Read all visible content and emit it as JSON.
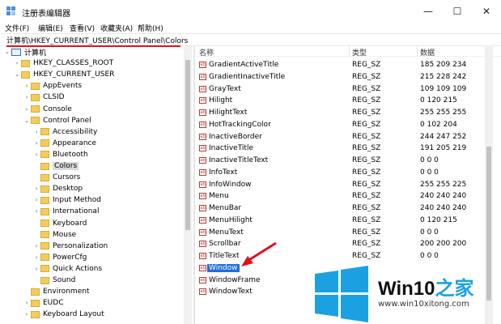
{
  "window": {
    "title": "注册表编辑器",
    "minimize": "—",
    "maximize": "☐",
    "close": "✕"
  },
  "menu": [
    "文件(F)",
    "编辑(E)",
    "查看(V)",
    "收藏夹(A)",
    "帮助(H)"
  ],
  "address": "计算机\\HKEY_CURRENT_USER\\Control Panel\\Colors",
  "tree": [
    {
      "label": "计算机",
      "exp": "⌄",
      "type": "computer",
      "depth": 0
    },
    {
      "label": "HKEY_CLASSES_ROOT",
      "exp": "›",
      "depth": 1
    },
    {
      "label": "HKEY_CURRENT_USER",
      "exp": "⌄",
      "depth": 1
    },
    {
      "label": "AppEvents",
      "exp": "›",
      "depth": 2
    },
    {
      "label": "CLSID",
      "exp": "›",
      "depth": 2
    },
    {
      "label": "Console",
      "exp": "›",
      "depth": 2
    },
    {
      "label": "Control Panel",
      "exp": "⌄",
      "depth": 2
    },
    {
      "label": "Accessibility",
      "exp": "›",
      "depth": 3
    },
    {
      "label": "Appearance",
      "exp": "›",
      "depth": 3
    },
    {
      "label": "Bluetooth",
      "exp": "›",
      "depth": 3
    },
    {
      "label": "Colors",
      "exp": "",
      "depth": 3,
      "selected": true
    },
    {
      "label": "Cursors",
      "exp": "",
      "depth": 3
    },
    {
      "label": "Desktop",
      "exp": "›",
      "depth": 3
    },
    {
      "label": "Input Method",
      "exp": "›",
      "depth": 3
    },
    {
      "label": "International",
      "exp": "›",
      "depth": 3
    },
    {
      "label": "Keyboard",
      "exp": "",
      "depth": 3
    },
    {
      "label": "Mouse",
      "exp": "",
      "depth": 3
    },
    {
      "label": "Personalization",
      "exp": "›",
      "depth": 3
    },
    {
      "label": "PowerCfg",
      "exp": "›",
      "depth": 3
    },
    {
      "label": "Quick Actions",
      "exp": "›",
      "depth": 3
    },
    {
      "label": "Sound",
      "exp": "",
      "depth": 3
    },
    {
      "label": "Environment",
      "exp": "",
      "depth": 2
    },
    {
      "label": "EUDC",
      "exp": "›",
      "depth": 2
    },
    {
      "label": "Keyboard Layout",
      "exp": "›",
      "depth": 2
    }
  ],
  "columns": {
    "name": "名称",
    "type": "类型",
    "data": "数据"
  },
  "values": [
    {
      "name": "GradientActiveTitle",
      "type": "REG_SZ",
      "data": "185 209 234"
    },
    {
      "name": "GradientInactiveTitle",
      "type": "REG_SZ",
      "data": "215 228 242"
    },
    {
      "name": "GrayText",
      "type": "REG_SZ",
      "data": "109 109 109"
    },
    {
      "name": "Hilight",
      "type": "REG_SZ",
      "data": "0 120 215"
    },
    {
      "name": "HilightText",
      "type": "REG_SZ",
      "data": "255 255 255"
    },
    {
      "name": "HotTrackingColor",
      "type": "REG_SZ",
      "data": "0 102 204"
    },
    {
      "name": "InactiveBorder",
      "type": "REG_SZ",
      "data": "244 247 252"
    },
    {
      "name": "InactiveTitle",
      "type": "REG_SZ",
      "data": "191 205 219"
    },
    {
      "name": "InactiveTitleText",
      "type": "REG_SZ",
      "data": "0 0 0"
    },
    {
      "name": "InfoText",
      "type": "REG_SZ",
      "data": "0 0 0"
    },
    {
      "name": "InfoWindow",
      "type": "REG_SZ",
      "data": "255 255 225"
    },
    {
      "name": "Menu",
      "type": "REG_SZ",
      "data": "240 240 240"
    },
    {
      "name": "MenuBar",
      "type": "REG_SZ",
      "data": "240 240 240"
    },
    {
      "name": "MenuHilight",
      "type": "REG_SZ",
      "data": "0 120 215"
    },
    {
      "name": "MenuText",
      "type": "REG_SZ",
      "data": "0 0 0"
    },
    {
      "name": "Scrollbar",
      "type": "REG_SZ",
      "data": "200 200 200"
    },
    {
      "name": "TitleText",
      "type": "REG_SZ",
      "data": "0 0 0"
    },
    {
      "name": "Window",
      "type": "",
      "data": "",
      "selected": true
    },
    {
      "name": "WindowFrame",
      "type": "",
      "data": ""
    },
    {
      "name": "WindowText",
      "type": "",
      "data": ""
    }
  ],
  "reg_icon_text": "ab",
  "logo": {
    "brand": "Win10",
    "brand_suffix": "之家",
    "url": "www.win10xitong.com"
  },
  "colors": {
    "accent": "#1f6fd6",
    "arrow": "#e0101b",
    "logo_blue": "#1ba1e2"
  }
}
